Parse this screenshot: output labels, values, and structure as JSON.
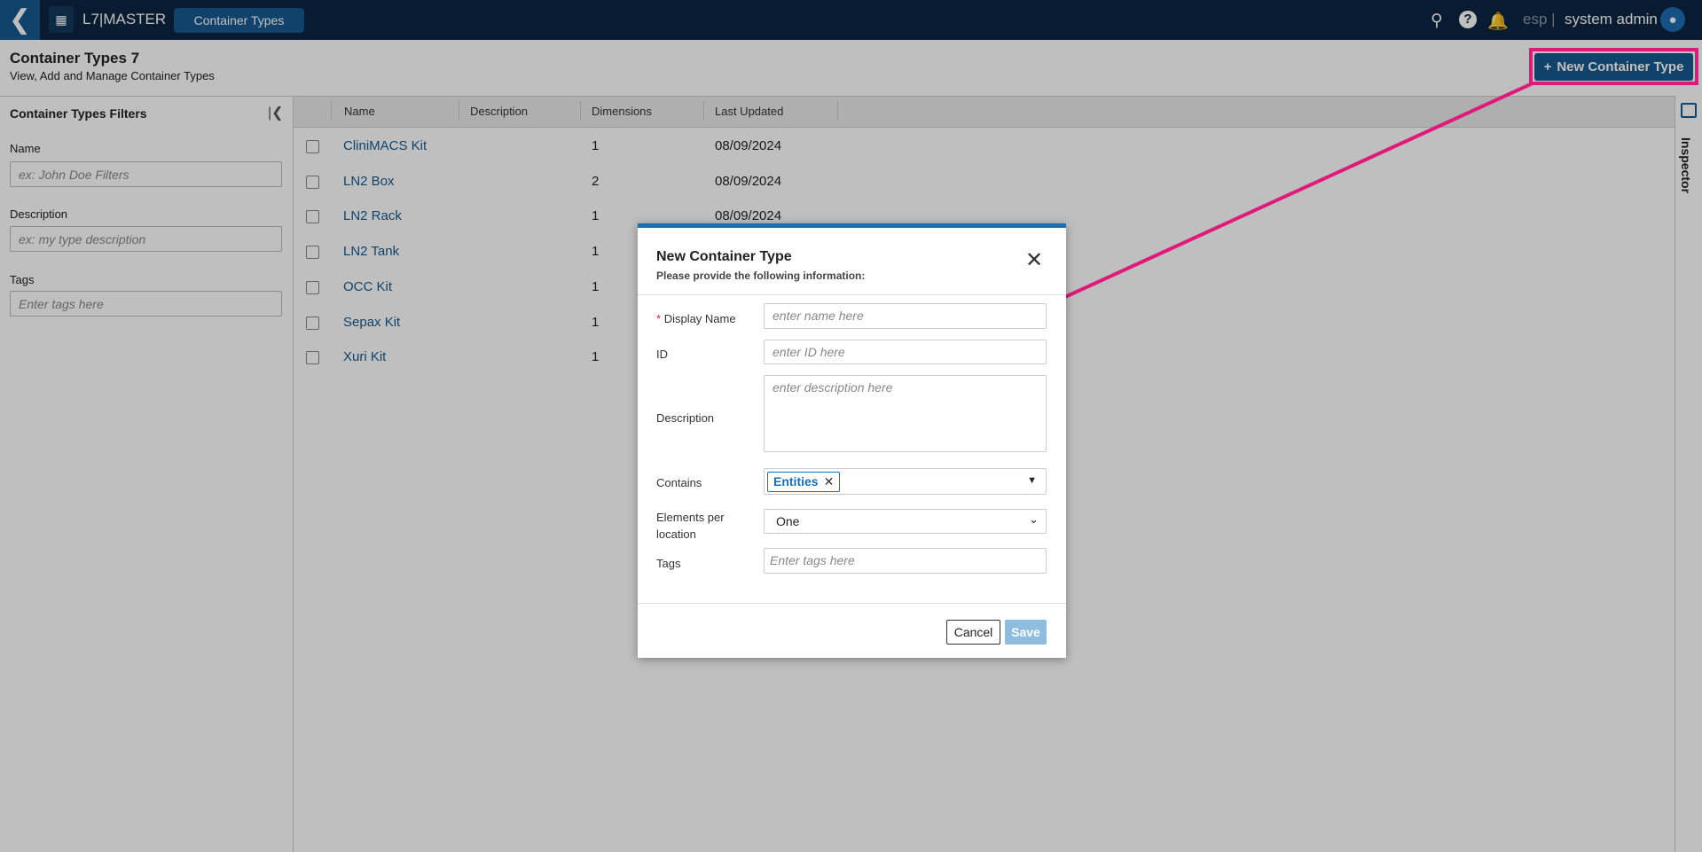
{
  "topbar": {
    "app_name": "L7|MASTER",
    "active_tab": "Container Types",
    "lang": "esp |",
    "user": "system admin"
  },
  "page": {
    "title": "Container Types 7",
    "subtitle": "View, Add and Manage Container Types",
    "new_button": "New Container Type"
  },
  "filters": {
    "title": "Container Types Filters",
    "fields": [
      {
        "label": "Name",
        "placeholder": "ex: John Doe Filters"
      },
      {
        "label": "Description",
        "placeholder": "ex: my type description"
      },
      {
        "label": "Tags",
        "placeholder": "Enter tags here"
      }
    ]
  },
  "table": {
    "columns": [
      "Name",
      "Description",
      "Dimensions",
      "Last Updated"
    ],
    "rows": [
      {
        "name": "CliniMACS Kit",
        "dimensions": "1",
        "updated": "08/09/2024"
      },
      {
        "name": "LN2 Box",
        "dimensions": "2",
        "updated": "08/09/2024"
      },
      {
        "name": "LN2 Rack",
        "dimensions": "1",
        "updated": "08/09/2024"
      },
      {
        "name": "LN2 Tank",
        "dimensions": "1",
        "updated": ""
      },
      {
        "name": "OCC Kit",
        "dimensions": "1",
        "updated": ""
      },
      {
        "name": "Sepax Kit",
        "dimensions": "1",
        "updated": ""
      },
      {
        "name": "Xuri Kit",
        "dimensions": "1",
        "updated": ""
      }
    ]
  },
  "inspector": {
    "label": "Inspector"
  },
  "modal": {
    "title": "New Container Type",
    "subtitle": "Please provide the following information:",
    "display_name_label": "Display Name",
    "required_mark": "*",
    "display_name_placeholder": "enter name here",
    "id_label": "ID",
    "id_placeholder": "enter ID here",
    "description_label": "Description",
    "description_placeholder": "enter description here",
    "contains_label": "Contains",
    "contains_tag": "Entities",
    "elements_label": "Elements per location",
    "elements_value": "One",
    "tags_label": "Tags",
    "tags_placeholder": "Enter tags here",
    "cancel": "Cancel",
    "save": "Save"
  },
  "colors": {
    "accent": "#16588f",
    "annotation": "#e01a7a",
    "topbar": "#0b2540"
  }
}
